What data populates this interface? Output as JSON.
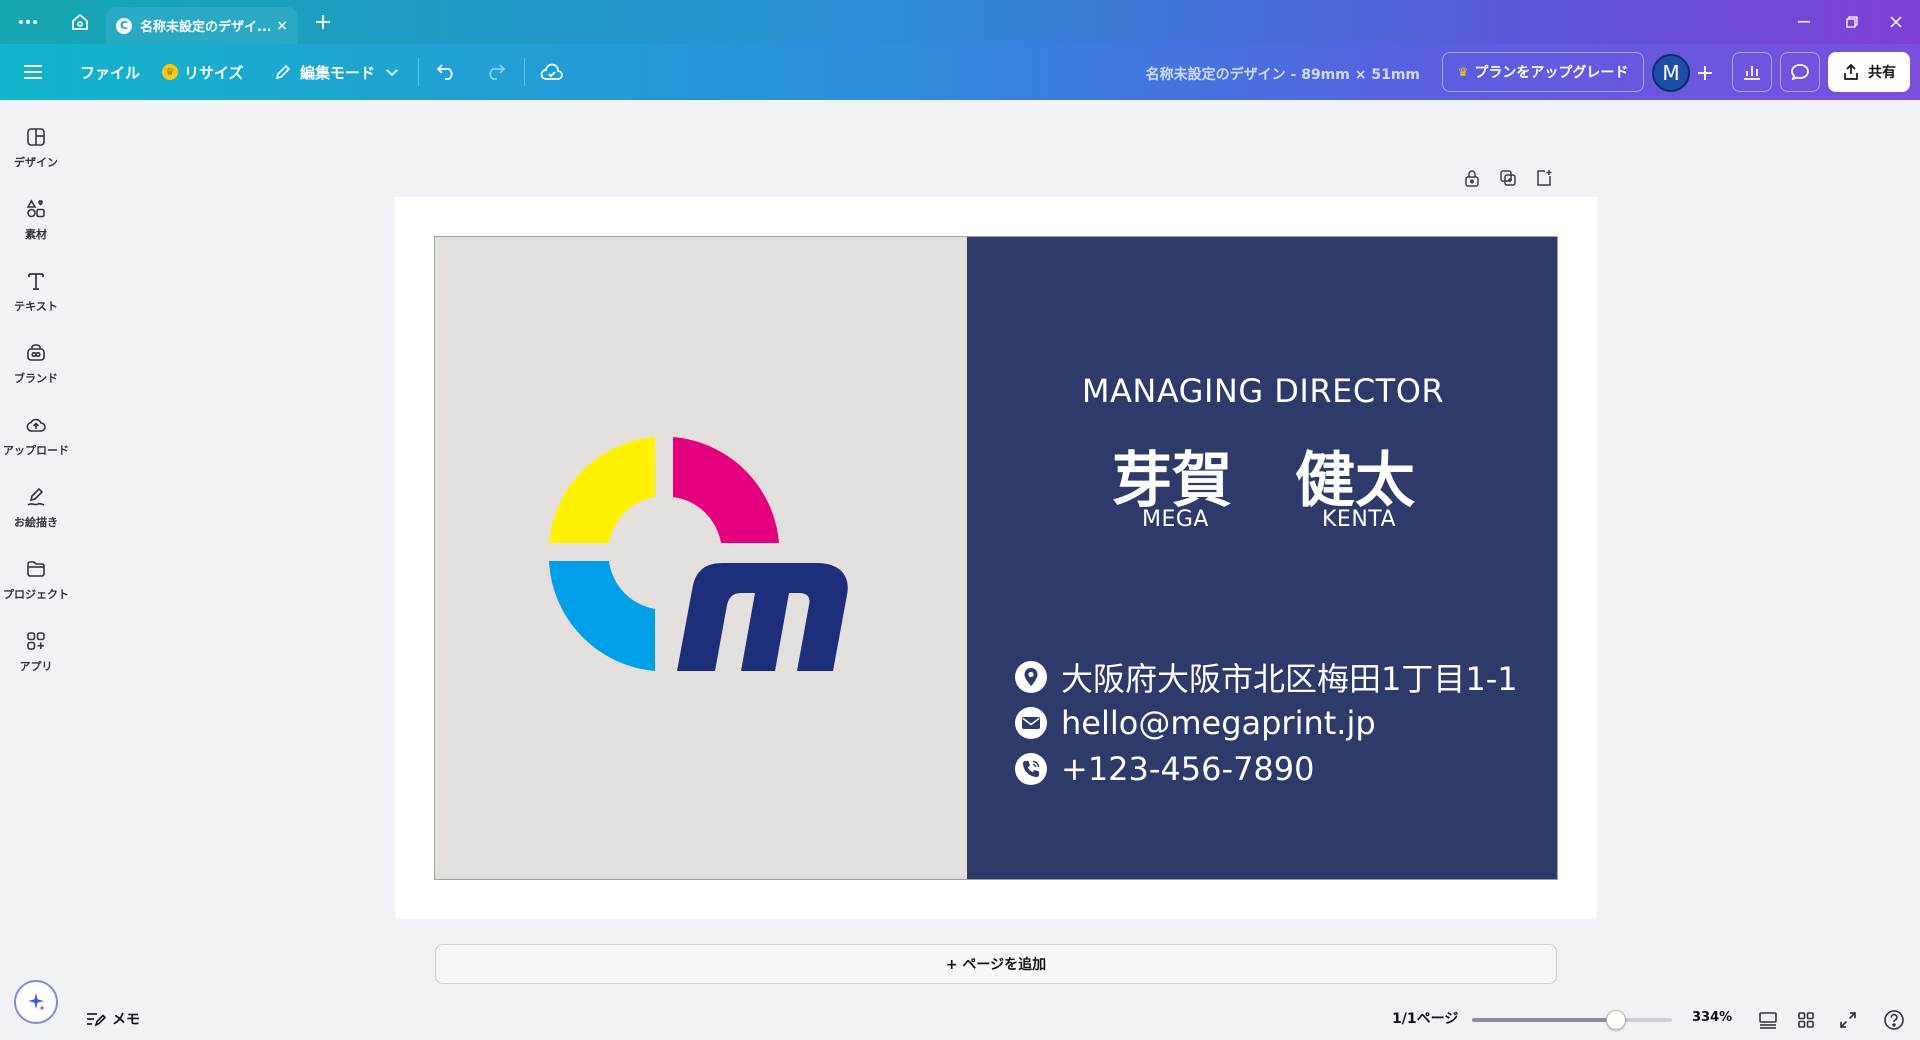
{
  "browser": {
    "tab_title": "名称未設定のデザイ...",
    "tab_favicon": "C",
    "close_glyph": "×",
    "new_tab_glyph": "+"
  },
  "toolbar": {
    "file_label": "ファイル",
    "resize_label": "リサイズ",
    "edit_mode_label": "編集モード",
    "doc_title": "名称未設定のデザイン - 89mm × 51mm",
    "upgrade_label": "プランをアップグレード",
    "avatar_initial": "M",
    "share_label": "共有"
  },
  "sidebar": {
    "items": [
      {
        "label": "デザイン",
        "icon": "layout-icon"
      },
      {
        "label": "素材",
        "icon": "shapes-icon"
      },
      {
        "label": "テキスト",
        "icon": "text-icon"
      },
      {
        "label": "ブランド",
        "icon": "brand-icon"
      },
      {
        "label": "アップロード",
        "icon": "upload-icon"
      },
      {
        "label": "お絵描き",
        "icon": "draw-icon"
      },
      {
        "label": "プロジェクト",
        "icon": "folder-icon"
      },
      {
        "label": "アプリ",
        "icon": "apps-icon"
      }
    ]
  },
  "card": {
    "job_title": "MANAGING DIRECTOR",
    "surname_jp": "芽賀",
    "given_jp": "健太",
    "surname_en": "MEGA",
    "given_en": "KENTA",
    "address": "大阪府大阪市北区梅田1丁目1-1",
    "email": "hello@megaprint.jp",
    "phone": "+123-456-7890",
    "colors": {
      "left_bg": "#e3dfdd",
      "right_bg": "#2d3a6a",
      "logo_yellow": "#fff200",
      "logo_magenta": "#e4007f",
      "logo_cyan": "#00a0e9",
      "logo_navy": "#1d2f7a"
    }
  },
  "canvas": {
    "add_page_label": "+ ページを追加"
  },
  "footer": {
    "notes_label": "メモ",
    "page_count": "1/1ページ",
    "zoom_label": "334%",
    "zoom_level": 0.72
  }
}
